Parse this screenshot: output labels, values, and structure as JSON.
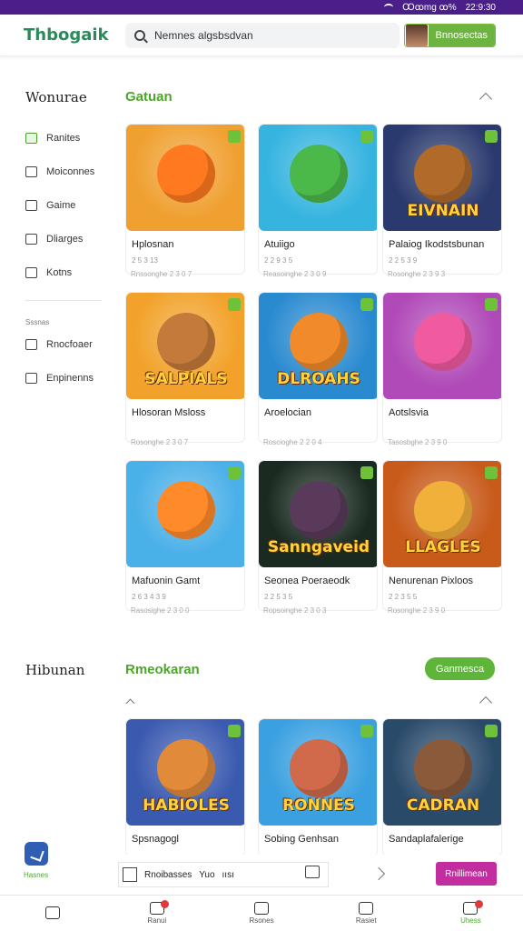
{
  "status_bar": {
    "left_text": "Ꝏꝏmg ꝏ%",
    "time": "22:9:30"
  },
  "header": {
    "logo": "Thbogaik",
    "search_placeholder": "Nemnes algsbsdvan",
    "connect_label": "Bnnosectas"
  },
  "sidebar": {
    "title": "Wonurae",
    "items": [
      {
        "label": "Ranites",
        "icon": "grid-icon",
        "active": true
      },
      {
        "label": "Moiconnes",
        "icon": "bolt-icon",
        "active": false
      },
      {
        "label": "Gaime",
        "icon": "gamepad-icon",
        "active": false
      },
      {
        "label": "Dliarges",
        "icon": "calendar-icon",
        "active": false
      },
      {
        "label": "Kotns",
        "icon": "person-icon",
        "active": false
      }
    ],
    "section_label": "Sssnas",
    "section_items": [
      {
        "label": "Rnocfoaer",
        "icon": "box-icon"
      },
      {
        "label": "Enpinenns",
        "icon": "share-icon"
      }
    ],
    "second_title": "Hibunan"
  },
  "sections": [
    {
      "title": "Gatuan",
      "cards": [
        {
          "name": "Hplosnan",
          "rating": "2 5 3 13",
          "meta": "Rnssonghe  2 3 0 7",
          "logo": "",
          "bg": "#f0a030",
          "face": "#ff7a1e"
        },
        {
          "name": "Atuiigo",
          "rating": "2 2 9 3 5",
          "meta": "Reasoinghe  2 3 0 9",
          "logo": "",
          "bg": "#36b4e0",
          "face": "#4bb84a"
        },
        {
          "name": "Palaiog Ikodstsbunan",
          "rating": "2 2 5 3  9",
          "meta": "Rosonghe  2 3 9 3",
          "logo": "EIVNAIN",
          "bg": "#2a3a6e",
          "face": "#b06a2a"
        },
        {
          "name": "Hlosoran Msloss",
          "rating": "",
          "meta": "Rosonghe  2 3 0 7",
          "logo": "SALPIALS",
          "bg": "#f2a22a",
          "face": "#c47a3a"
        },
        {
          "name": "Aroelocian",
          "rating": "",
          "meta": "Roscioghe  2 2 0 4",
          "logo": "DLROAHS",
          "bg": "#2a8ad0",
          "face": "#f08a2a"
        },
        {
          "name": "Aotslsvia",
          "rating": "",
          "meta": "Tasosbghe  2 3 9 0",
          "logo": "",
          "bg": "#b04ab8",
          "face": "#f05aa0"
        },
        {
          "name": "Mafuonin Gamt",
          "rating": "2 6 3 4 3 9",
          "meta": "Rasosighe  2 3 0 0",
          "logo": "",
          "bg": "#4ab0e8",
          "face": "#ff8a2a"
        },
        {
          "name": "Seonea Poeraeodk",
          "rating": "2 2 5 3 5",
          "meta": "Ropsoinghe  2 3 0 3",
          "logo": "Sanngaveid",
          "bg": "#1a2a20",
          "face": "#5a3a5a"
        },
        {
          "name": "Nenurenan Pixloos",
          "rating": "2 2 3 5 5",
          "meta": "Rosonghe  2 3 9 0",
          "logo": "LLAGLES",
          "bg": "#c85a1a",
          "face": "#f0b03a"
        }
      ]
    },
    {
      "title": "Rmeokaran",
      "button": "Ganmesca",
      "cards": [
        {
          "name": "Spsnagogl",
          "logo": "HABIOLES",
          "bg": "#3a5ab0",
          "face": "#e08a3a"
        },
        {
          "name": "Sobing Genhsan",
          "logo": "RONNES",
          "bg": "#3aa0e0",
          "face": "#d06a4a"
        },
        {
          "name": "Sandaplafalerige",
          "logo": "CADRAN",
          "bg": "#2a4a6a",
          "face": "#8a5a3a"
        }
      ]
    }
  ],
  "action_bar": {
    "fab_label": "Hasnes",
    "labels": [
      "Rnoibasses",
      "Yuo",
      "ıısı"
    ],
    "button": "Rnillimean"
  },
  "bottom_nav": [
    {
      "label": "",
      "icon": "home-icon",
      "badge": false
    },
    {
      "label": "Ranui",
      "icon": "bell-icon",
      "badge": true
    },
    {
      "label": "Rsones",
      "icon": "house-icon",
      "badge": false
    },
    {
      "label": "Rasiet",
      "icon": "user-icon",
      "badge": false
    },
    {
      "label": "Uhess",
      "icon": "bag-icon",
      "badge": true
    }
  ],
  "colors": {
    "accent": "#5fb53a",
    "brand_purple": "#4a1f8a",
    "pink": "#c22ea0"
  }
}
